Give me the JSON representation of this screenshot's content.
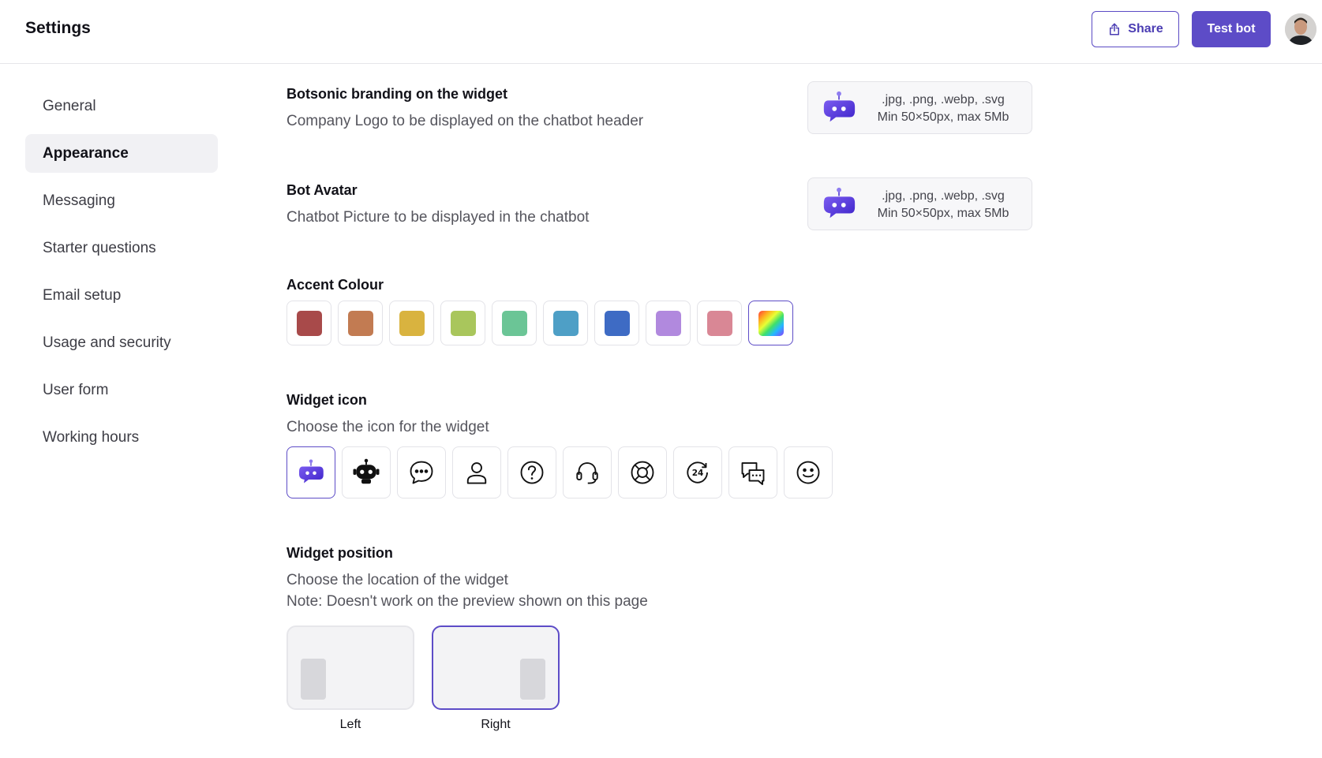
{
  "header": {
    "title": "Settings",
    "share_label": "Share",
    "test_bot_label": "Test bot"
  },
  "sidebar": {
    "items": [
      {
        "label": "General",
        "active": false
      },
      {
        "label": "Appearance",
        "active": true
      },
      {
        "label": "Messaging",
        "active": false
      },
      {
        "label": "Starter questions",
        "active": false
      },
      {
        "label": "Email setup",
        "active": false
      },
      {
        "label": "Usage and security",
        "active": false
      },
      {
        "label": "User form",
        "active": false
      },
      {
        "label": "Working hours",
        "active": false
      }
    ]
  },
  "branding": {
    "title": "Botsonic branding on the widget",
    "description": "Company Logo to be displayed on the chatbot header",
    "upload_formats": ".jpg, .png, .webp, .svg",
    "upload_limits": "Min 50×50px, max 5Mb"
  },
  "bot_avatar": {
    "title": "Bot Avatar",
    "description": "Chatbot Picture to be displayed in the chatbot",
    "upload_formats": ".jpg, .png, .webp, .svg",
    "upload_limits": "Min 50×50px, max 5Mb"
  },
  "accent": {
    "title": "Accent Colour",
    "colors": [
      "#a84a4a",
      "#c27b52",
      "#d9b33f",
      "#a9c65c",
      "#6bc596",
      "#4e9fc6",
      "#3e6bc4",
      "#b189de",
      "#d98795",
      "rainbow-gradient"
    ],
    "selected_index": 9
  },
  "widget_icon": {
    "title": "Widget icon",
    "description": "Choose the icon for the widget",
    "icons": [
      "botsonic-bot-icon",
      "robot-icon",
      "chat-bubble-icon",
      "user-icon",
      "question-icon",
      "headset-icon",
      "lifebuoy-icon",
      "24-hours-icon",
      "chat-conversation-icon",
      "smiley-icon"
    ],
    "selected_index": 0
  },
  "widget_position": {
    "title": "Widget position",
    "description": "Choose the location of the widget",
    "note": "Note: Doesn't work on the preview shown on this page",
    "options": [
      "Left",
      "Right"
    ],
    "selected": "Right"
  }
}
